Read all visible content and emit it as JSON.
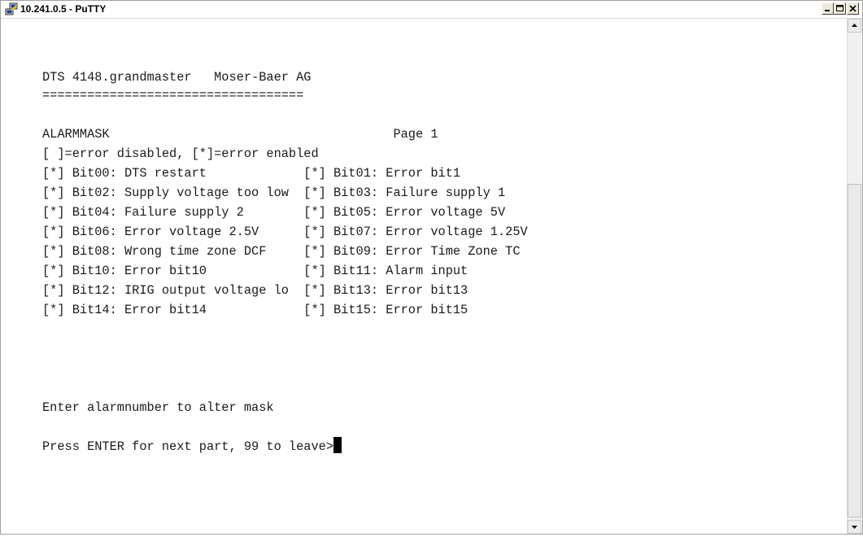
{
  "window": {
    "title": "10.241.0.5 - PuTTY",
    "controls": [
      "minimize",
      "maximize",
      "close"
    ]
  },
  "terminal": {
    "header": "DTS 4148.grandmaster   Moser-Baer AG",
    "separator": "===================================",
    "section_title": "ALARMMASK                                      Page 1",
    "legend": "[ ]=error disabled, [*]=error enabled",
    "alarm_rows": [
      "[*] Bit00: DTS restart             [*] Bit01: Error bit1",
      "[*] Bit02: Supply voltage too low  [*] Bit03: Failure supply 1",
      "[*] Bit04: Failure supply 2        [*] Bit05: Error voltage 5V",
      "[*] Bit06: Error voltage 2.5V      [*] Bit07: Error voltage 1.25V",
      "[*] Bit08: Wrong time zone DCF     [*] Bit09: Error Time Zone TC",
      "[*] Bit10: Error bit10             [*] Bit11: Alarm input",
      "[*] Bit12: IRIG output voltage lo  [*] Bit13: Error bit13",
      "[*] Bit14: Error bit14             [*] Bit15: Error bit15"
    ],
    "instruction": "Enter alarmnumber to alter mask",
    "prompt": "Press ENTER for next part, 99 to leave>"
  },
  "icons": {
    "app": "putty-icon",
    "minimize": "minimize-icon",
    "maximize": "maximize-icon",
    "close": "close-icon",
    "scroll_up": "arrow-up-icon",
    "scroll_down": "arrow-down-icon"
  }
}
